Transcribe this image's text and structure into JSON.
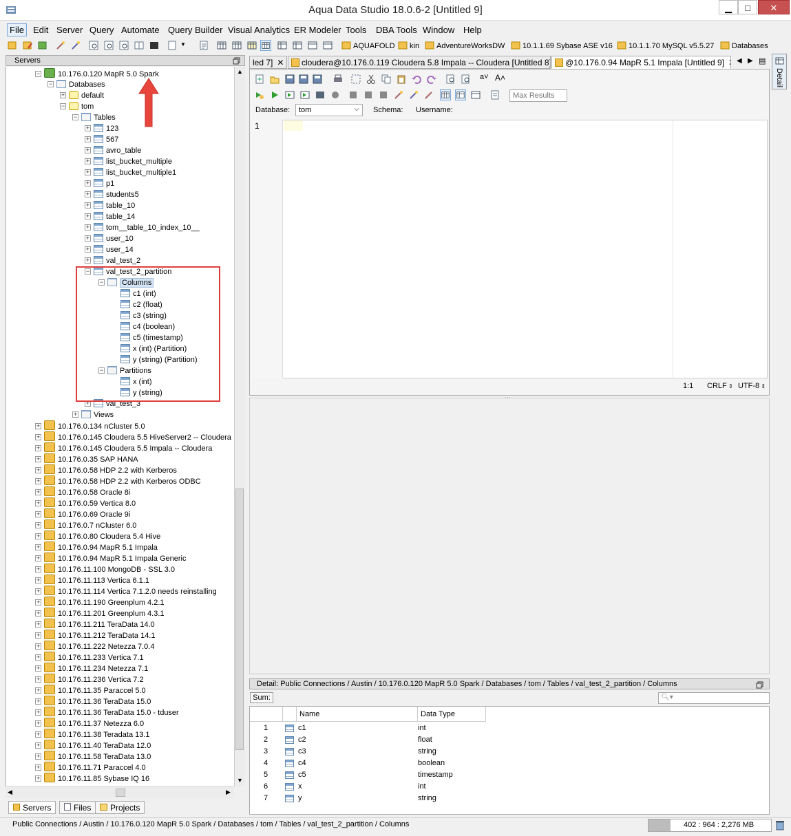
{
  "window": {
    "title": "Aqua Data Studio 18.0.6-2 [Untitled 9]",
    "minimize": "▁",
    "maximize": "□",
    "close": "✕"
  },
  "menu": [
    "File",
    "Edit",
    "Server",
    "Query",
    "Automate",
    "Query Builder",
    "Visual Analytics",
    "ER Modeler",
    "Tools",
    "DBA Tools",
    "Window",
    "Help"
  ],
  "toolbar_connections": [
    "AQUAFOLD",
    "kin",
    "AdventureWorksDW",
    "10.1.1.69 Sybase ASE v16",
    "10.1.1.70 MySQL v5.5.27",
    "Databases"
  ],
  "servers_pane": {
    "title": "Servers",
    "tree": [
      {
        "label": "10.176.0.120 MapR 5.0 Spark",
        "level": 0,
        "icon": "server-ok",
        "toggle": "−"
      },
      {
        "label": "Databases",
        "level": 1,
        "icon": "folder",
        "toggle": "−"
      },
      {
        "label": "default",
        "level": 2,
        "icon": "db",
        "toggle": "+"
      },
      {
        "label": "tom",
        "level": 2,
        "icon": "db",
        "toggle": "−"
      },
      {
        "label": "Tables",
        "level": 3,
        "icon": "folder",
        "toggle": "−"
      },
      {
        "label": "123",
        "level": 4,
        "icon": "table",
        "toggle": "+"
      },
      {
        "label": "567",
        "level": 4,
        "icon": "table",
        "toggle": "+"
      },
      {
        "label": "avro_table",
        "level": 4,
        "icon": "table",
        "toggle": "+"
      },
      {
        "label": "list_bucket_multiple",
        "level": 4,
        "icon": "table",
        "toggle": "+"
      },
      {
        "label": "list_bucket_multiple1",
        "level": 4,
        "icon": "table",
        "toggle": "+"
      },
      {
        "label": "p1",
        "level": 4,
        "icon": "table",
        "toggle": "+"
      },
      {
        "label": "students5",
        "level": 4,
        "icon": "table",
        "toggle": "+"
      },
      {
        "label": "table_10",
        "level": 4,
        "icon": "table",
        "toggle": "+"
      },
      {
        "label": "table_14",
        "level": 4,
        "icon": "table",
        "toggle": "+"
      },
      {
        "label": "tom__table_10_index_10__",
        "level": 4,
        "icon": "table",
        "toggle": "+"
      },
      {
        "label": "user_10",
        "level": 4,
        "icon": "table",
        "toggle": "+"
      },
      {
        "label": "user_14",
        "level": 4,
        "icon": "table",
        "toggle": "+"
      },
      {
        "label": "val_test_2",
        "level": 4,
        "icon": "table",
        "toggle": "+"
      },
      {
        "label": "val_test_2_partition",
        "level": 4,
        "icon": "table",
        "toggle": "−"
      },
      {
        "label": "Columns",
        "level": 5,
        "icon": "folder",
        "toggle": "−",
        "selected": true
      },
      {
        "label": "c1 (int)",
        "level": 6,
        "icon": "table",
        "toggle": ""
      },
      {
        "label": "c2 (float)",
        "level": 6,
        "icon": "table",
        "toggle": ""
      },
      {
        "label": "c3 (string)",
        "level": 6,
        "icon": "table",
        "toggle": ""
      },
      {
        "label": "c4 (boolean)",
        "level": 6,
        "icon": "table",
        "toggle": ""
      },
      {
        "label": "c5 (timestamp)",
        "level": 6,
        "icon": "table",
        "toggle": ""
      },
      {
        "label": "x (int) (Partition)",
        "level": 6,
        "icon": "table",
        "toggle": ""
      },
      {
        "label": "y (string) (Partition)",
        "level": 6,
        "icon": "table",
        "toggle": ""
      },
      {
        "label": "Partitions",
        "level": 5,
        "icon": "folder",
        "toggle": "−"
      },
      {
        "label": "x (int)",
        "level": 6,
        "icon": "table",
        "toggle": ""
      },
      {
        "label": "y (string)",
        "level": 6,
        "icon": "table",
        "toggle": ""
      },
      {
        "label": "val_test_3",
        "level": 4,
        "icon": "table",
        "toggle": "+"
      },
      {
        "label": "Views",
        "level": 3,
        "icon": "folder",
        "toggle": "+"
      },
      {
        "label": "10.176.0.134 nCluster 5.0",
        "level": 0,
        "icon": "server",
        "toggle": "+"
      },
      {
        "label": "10.176.0.145 Cloudera 5.5 HiveServer2 -- Cloudera",
        "level": 0,
        "icon": "server",
        "toggle": "+"
      },
      {
        "label": "10.176.0.145 Cloudera 5.5 Impala -- Cloudera",
        "level": 0,
        "icon": "server",
        "toggle": "+"
      },
      {
        "label": "10.176.0.35 SAP HANA",
        "level": 0,
        "icon": "server",
        "toggle": "+"
      },
      {
        "label": "10.176.0.58 HDP 2.2 with Kerberos",
        "level": 0,
        "icon": "server",
        "toggle": "+"
      },
      {
        "label": "10.176.0.58 HDP 2.2 with Kerberos ODBC",
        "level": 0,
        "icon": "server",
        "toggle": "+"
      },
      {
        "label": "10.176.0.58 Oracle 8i",
        "level": 0,
        "icon": "server",
        "toggle": "+"
      },
      {
        "label": "10.176.0.59 Vertica 8.0",
        "level": 0,
        "icon": "server",
        "toggle": "+"
      },
      {
        "label": "10.176.0.69 Oracle 9i",
        "level": 0,
        "icon": "server",
        "toggle": "+"
      },
      {
        "label": "10.176.0.7 nCluster 6.0",
        "level": 0,
        "icon": "server",
        "toggle": "+"
      },
      {
        "label": "10.176.0.80 Cloudera 5.4 Hive",
        "level": 0,
        "icon": "server",
        "toggle": "+"
      },
      {
        "label": "10.176.0.94 MapR 5.1 Impala",
        "level": 0,
        "icon": "server",
        "toggle": "+"
      },
      {
        "label": "10.176.0.94 MapR 5.1 Impala Generic",
        "level": 0,
        "icon": "server",
        "toggle": "+"
      },
      {
        "label": "10.176.11.100 MongoDB - SSL 3.0",
        "level": 0,
        "icon": "server",
        "toggle": "+"
      },
      {
        "label": "10.176.11.113 Vertica 6.1.1",
        "level": 0,
        "icon": "server",
        "toggle": "+"
      },
      {
        "label": "10.176.11.114 Vertica 7.1.2.0  needs reinstalling",
        "level": 0,
        "icon": "server",
        "toggle": "+"
      },
      {
        "label": "10.176.11.190 Greenplum 4.2.1",
        "level": 0,
        "icon": "server",
        "toggle": "+"
      },
      {
        "label": "10.176.11.201 Greenplum 4.3.1",
        "level": 0,
        "icon": "server",
        "toggle": "+"
      },
      {
        "label": "10.176.11.211 TeraData 14.0",
        "level": 0,
        "icon": "server",
        "toggle": "+"
      },
      {
        "label": "10.176.11.212 TeraData 14.1",
        "level": 0,
        "icon": "server",
        "toggle": "+"
      },
      {
        "label": "10.176.11.222 Netezza 7.0.4",
        "level": 0,
        "icon": "server",
        "toggle": "+"
      },
      {
        "label": "10.176.11.233 Vertica 7.1",
        "level": 0,
        "icon": "server",
        "toggle": "+"
      },
      {
        "label": "10.176.11.234 Netezza 7.1",
        "level": 0,
        "icon": "server",
        "toggle": "+"
      },
      {
        "label": "10.176.11.236 Vertica 7.2",
        "level": 0,
        "icon": "server",
        "toggle": "+"
      },
      {
        "label": "10.176.11.35 Paraccel 5.0",
        "level": 0,
        "icon": "server",
        "toggle": "+"
      },
      {
        "label": "10.176.11.36 TeraData 15.0",
        "level": 0,
        "icon": "server",
        "toggle": "+"
      },
      {
        "label": "10.176.11.36 TeraData 15.0 - tduser",
        "level": 0,
        "icon": "server",
        "toggle": "+"
      },
      {
        "label": "10.176.11.37 Netezza 6.0",
        "level": 0,
        "icon": "server",
        "toggle": "+"
      },
      {
        "label": "10.176.11.38 Teradata 13.1",
        "level": 0,
        "icon": "server",
        "toggle": "+"
      },
      {
        "label": "10.176.11.40 TeraData 12.0",
        "level": 0,
        "icon": "server",
        "toggle": "+"
      },
      {
        "label": "10.176.11.58 TeraData 13.0",
        "level": 0,
        "icon": "server",
        "toggle": "+"
      },
      {
        "label": "10.176.11.71 Paraccel 4.0",
        "level": 0,
        "icon": "server",
        "toggle": "+"
      },
      {
        "label": "10.176.11.85 Sybase IQ 16",
        "level": 0,
        "icon": "server",
        "toggle": "+"
      }
    ],
    "tabs": [
      "Servers",
      "Files",
      "Projects"
    ]
  },
  "editor": {
    "tabs": [
      {
        "label": "led 7]",
        "active": false
      },
      {
        "label": "cloudera@10.176.0.119 Cloudera 5.8 Impala -- Cloudera [Untitled 8]",
        "active": false
      },
      {
        "label": "@10.176.0.94 MapR 5.1 Impala [Untitled 9]",
        "active": true
      }
    ],
    "max_results_placeholder": "Max Results",
    "database_label": "Database:",
    "database_value": "tom",
    "schema_label": "Schema:",
    "username_label": "Username:",
    "line_number": "1",
    "cursor_pos": "1:1",
    "line_ending": "CRLF",
    "encoding": "UTF-8"
  },
  "detail": {
    "path": "Detail: Public Connections / Austin / 10.176.0.120 MapR 5.0 Spark / Databases / tom / Tables / val_test_2_partition / Columns",
    "sum_label": "Sum:",
    "columns": [
      "Name",
      "Data Type"
    ],
    "rows": [
      {
        "n": "1",
        "name": "c1",
        "type": "int"
      },
      {
        "n": "2",
        "name": "c2",
        "type": "float"
      },
      {
        "n": "3",
        "name": "c3",
        "type": "string"
      },
      {
        "n": "4",
        "name": "c4",
        "type": "boolean"
      },
      {
        "n": "5",
        "name": "c5",
        "type": "timestamp"
      },
      {
        "n": "6",
        "name": "x",
        "type": "int"
      },
      {
        "n": "7",
        "name": "y",
        "type": "string"
      }
    ],
    "side_tab": "Detail"
  },
  "status": {
    "path": "Public Connections / Austin / 10.176.0.120 MapR 5.0 Spark / Databases / tom / Tables / val_test_2_partition / Columns",
    "memory": "402 : 964 : 2,276 MB",
    "memory_fraction": 0.18
  },
  "colors": {
    "highlight_box": "#e03c3c",
    "accent": "#7aa7d8"
  }
}
